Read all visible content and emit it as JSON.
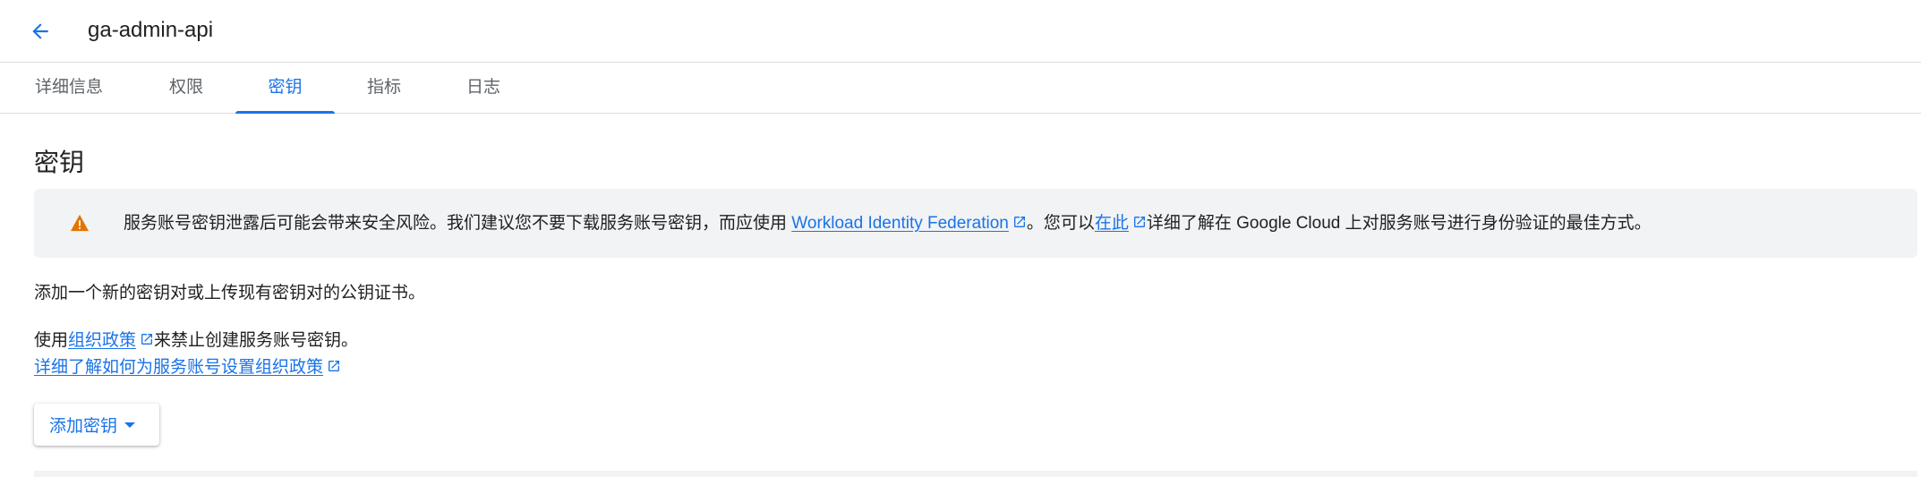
{
  "header": {
    "title": "ga-admin-api"
  },
  "tabs": [
    {
      "label": "详细信息"
    },
    {
      "label": "权限"
    },
    {
      "label": "密钥",
      "active": true
    },
    {
      "label": "指标"
    },
    {
      "label": "日志"
    }
  ],
  "section": {
    "title": "密钥"
  },
  "banner": {
    "icon": "warning-icon",
    "text_before": "服务账号密钥泄露后可能会带来安全风险。我们建议您不要下载服务账号密钥，而应使用 ",
    "link1": "Workload Identity Federation",
    "text_middle": "。您可以",
    "link2": "在此",
    "text_after": "详细了解在 Google Cloud 上对服务账号进行身份验证的最佳方式。"
  },
  "content": {
    "intro": "添加一个新的密钥对或上传现有密钥对的公钥证书。",
    "policy_prefix": "使用",
    "policy_link": "组织政策",
    "policy_suffix": "来禁止创建服务账号密钥。",
    "learn_more_link": "详细了解如何为服务账号设置组织政策"
  },
  "actions": {
    "add_key_label": "添加密钥"
  },
  "colors": {
    "accent": "#1a73e8",
    "warning": "#e37400",
    "banner_bg": "#f1f3f4"
  }
}
